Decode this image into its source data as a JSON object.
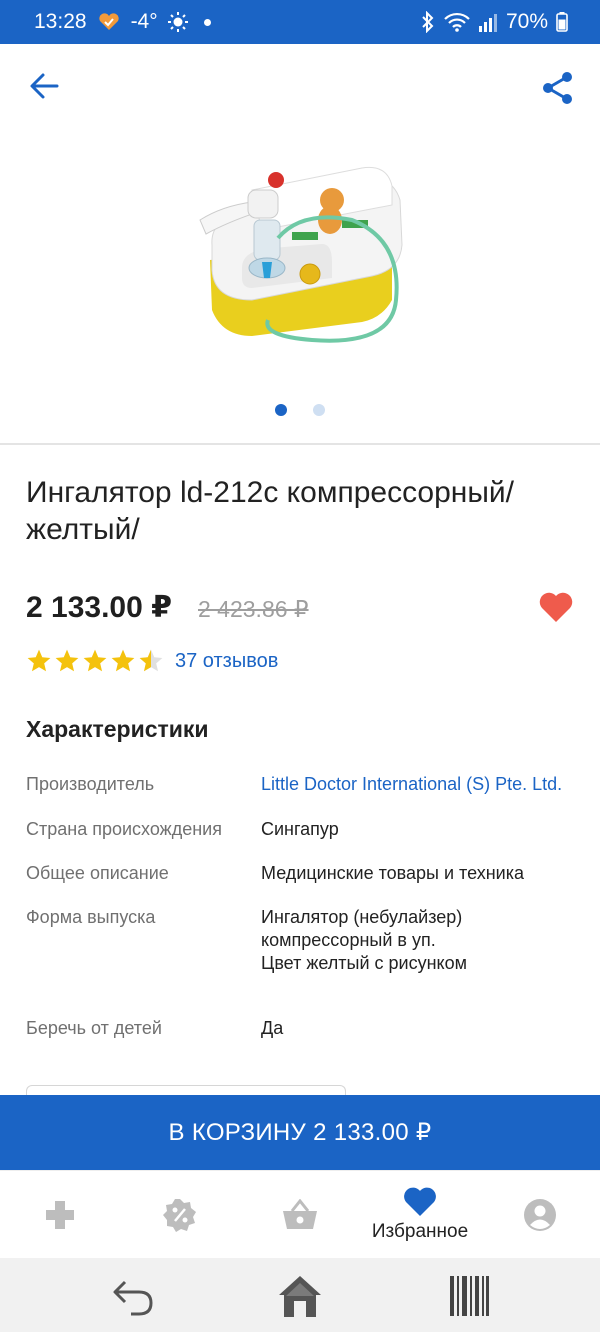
{
  "status_bar": {
    "time": "13:28",
    "temperature": "-4°",
    "battery": "70%"
  },
  "product": {
    "title": "Ингалятор ld-212c компрессорный/ желтый/",
    "price": "2 133.00 ₽",
    "old_price": "2 423.86 ₽",
    "rating": 4.5,
    "reviews": "37 отзывов",
    "gallery_pages": 2,
    "gallery_active": 0
  },
  "characteristics": {
    "title": "Характеристики",
    "rows": [
      {
        "label": "Производитель",
        "value": "Little Doctor International (S) Pte. Ltd."
      },
      {
        "label": "Страна происхождения",
        "value": "Сингапур"
      },
      {
        "label": "Общее описание",
        "value": "Медицинские товары и техника"
      },
      {
        "label": "Форма выпуска",
        "value": "Ингалятор (небулайзер)\nкомпрессорный в уп.\nЦвет желтый с рисунком"
      },
      {
        "label": "Беречь от детей",
        "value": "Да"
      }
    ]
  },
  "cart_button": {
    "label": "В КОРЗИНУ 2 133.00 ₽"
  },
  "bottom_nav": {
    "items": [
      {
        "icon": "pharmacy-cross-icon",
        "label": ""
      },
      {
        "icon": "discount-badge-icon",
        "label": ""
      },
      {
        "icon": "basket-icon",
        "label": ""
      },
      {
        "icon": "heart-icon",
        "label": "Избранное",
        "active": true
      },
      {
        "icon": "profile-icon",
        "label": ""
      }
    ]
  },
  "colors": {
    "brand": "#1b64c5",
    "favorite": "#ef5b4c",
    "star": "#f4c20d"
  }
}
